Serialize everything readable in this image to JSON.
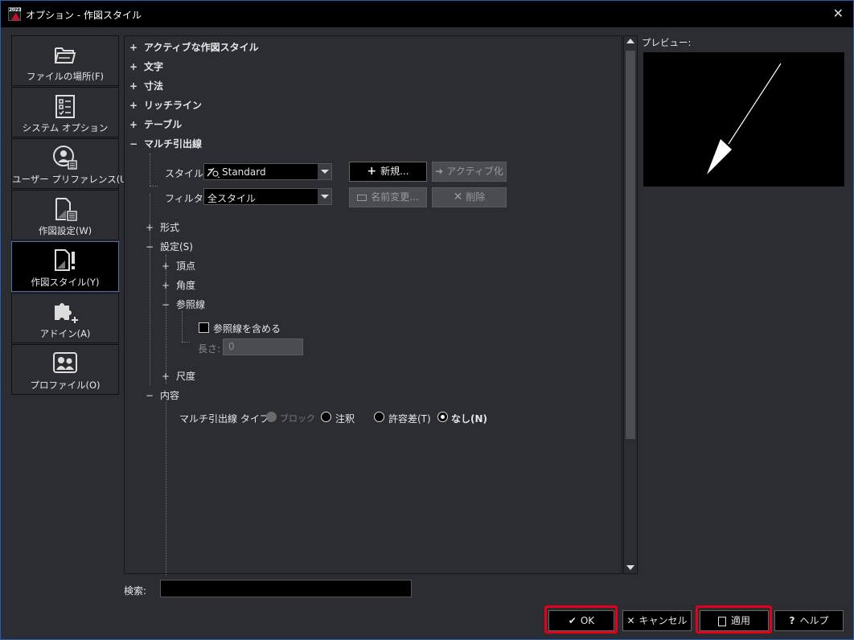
{
  "window": {
    "title": "オプション - 作図スタイル",
    "app_badge": "2023"
  },
  "nav": [
    {
      "label": "ファイルの場所(F)",
      "icon": "folder-icon"
    },
    {
      "label": "システム オプション",
      "icon": "checklist-icon"
    },
    {
      "label": "ユーザー プリファレンス(U)",
      "icon": "user-preferences-icon"
    },
    {
      "label": "作図設定(W)",
      "icon": "drawing-settings-icon"
    },
    {
      "label": "作図スタイル(Y)",
      "icon": "drafting-style-icon",
      "active": true
    },
    {
      "label": "アドイン(A)",
      "icon": "puzzle-plus-icon"
    },
    {
      "label": "プロファイル(O)",
      "icon": "profile-icon"
    }
  ],
  "tree": {
    "active_style": "アクティブな作図スタイル",
    "text": "文字",
    "dimension": "寸法",
    "rich_line": "リッチライン",
    "table": "テーブル",
    "multileader": "マルチ引出線",
    "style_label": "スタイル:",
    "style_value": "Standard",
    "filter_label": "フィルタ:",
    "filter_value": "全スタイル",
    "new_btn": "新規...",
    "activate_btn": "アクティブ化",
    "rename_btn": "名前変更...",
    "delete_btn": "削除",
    "format": "形式",
    "settings": "設定(S)",
    "vertex": "頂点",
    "angle": "角度",
    "reference_line": "参照線",
    "include_reference_line": "参照線を含める",
    "length_label": "長さ:",
    "length_value": "0",
    "scale": "尺度",
    "content": "内容",
    "ml_type_label": "マルチ引出線 タイプ:",
    "type_block": "ブロック",
    "type_note": "注釈",
    "type_tolerance": "許容差(T)",
    "type_none": "なし(N)",
    "selected_type": "none"
  },
  "preview": {
    "label": "プレビュー:"
  },
  "search": {
    "label": "検索:",
    "value": ""
  },
  "buttons": {
    "ok": "OK",
    "cancel": "キャンセル",
    "apply": "適用",
    "help": "ヘルプ"
  },
  "colors": {
    "highlight": "#e3001b",
    "accent_border": "#1f5fb8",
    "panel_bg": "#2b2d33"
  }
}
